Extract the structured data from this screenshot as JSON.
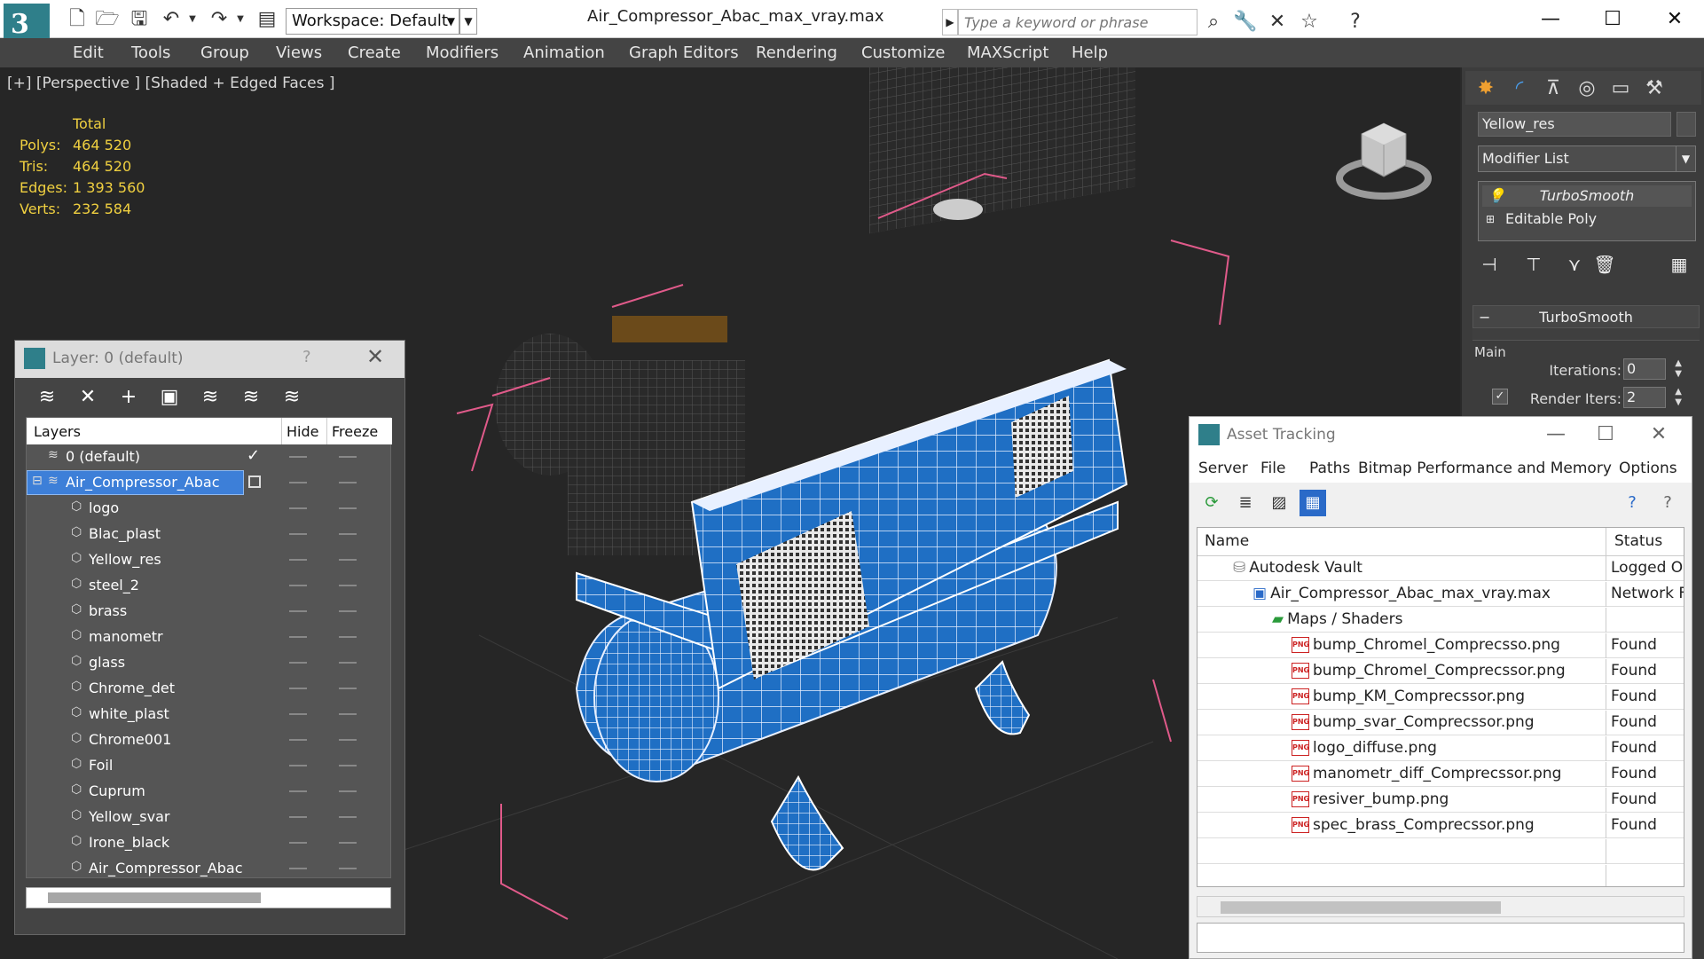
{
  "titlebar": {
    "workspace": "Workspace: Default",
    "document_title": "Air_Compressor_Abac_max_vray.max",
    "search_placeholder": "Type a keyword or phrase"
  },
  "menu": [
    "Edit",
    "Tools",
    "Group",
    "Views",
    "Create",
    "Modifiers",
    "Animation",
    "Graph Editors",
    "Rendering",
    "Customize",
    "MAXScript",
    "Help"
  ],
  "viewport": {
    "label": "[+] [Perspective ] [Shaded + Edged Faces ]",
    "stats": {
      "header": "Total",
      "rows": [
        {
          "label": "Polys:",
          "value": "464 520"
        },
        {
          "label": "Tris:",
          "value": "464 520"
        },
        {
          "label": "Edges:",
          "value": "1 393 560"
        },
        {
          "label": "Verts:",
          "value": "232 584"
        }
      ]
    }
  },
  "command_panel": {
    "object_name": "Yellow_res",
    "modifier_list": "Modifier List",
    "stack": [
      "TurboSmooth",
      "Editable Poly"
    ],
    "rollout_title": "TurboSmooth",
    "group_label": "Main",
    "iterations_label": "Iterations:",
    "iterations_value": "0",
    "render_iters_label": "Render Iters:",
    "render_iters_value": "2"
  },
  "layer_dialog": {
    "title": "Layer: 0 (default)",
    "help": "?",
    "columns": {
      "layers": "Layers",
      "hide": "Hide",
      "freeze": "Freeze"
    },
    "rows": [
      {
        "name": "0 (default)",
        "level": 0,
        "kind": "layer"
      },
      {
        "name": "Air_Compressor_Abac",
        "level": 0,
        "kind": "layer",
        "selected": true
      },
      {
        "name": "logo",
        "level": 1,
        "kind": "object"
      },
      {
        "name": "Blac_plast",
        "level": 1,
        "kind": "object"
      },
      {
        "name": "Yellow_res",
        "level": 1,
        "kind": "object"
      },
      {
        "name": "steel_2",
        "level": 1,
        "kind": "object"
      },
      {
        "name": "brass",
        "level": 1,
        "kind": "object"
      },
      {
        "name": "manometr",
        "level": 1,
        "kind": "object"
      },
      {
        "name": "glass",
        "level": 1,
        "kind": "object"
      },
      {
        "name": "Chrome_det",
        "level": 1,
        "kind": "object"
      },
      {
        "name": "white_plast",
        "level": 1,
        "kind": "object"
      },
      {
        "name": "Chrome001",
        "level": 1,
        "kind": "object"
      },
      {
        "name": "Foil",
        "level": 1,
        "kind": "object"
      },
      {
        "name": "Cuprum",
        "level": 1,
        "kind": "object"
      },
      {
        "name": "Yellow_svar",
        "level": 1,
        "kind": "object"
      },
      {
        "name": "Irone_black",
        "level": 1,
        "kind": "object"
      },
      {
        "name": "Air_Compressor_Abac",
        "level": 1,
        "kind": "object"
      }
    ]
  },
  "asset_dialog": {
    "title": "Asset Tracking",
    "menu": [
      "Server",
      "File",
      "Paths",
      "Bitmap Performance and Memory",
      "Options"
    ],
    "columns": {
      "name": "Name",
      "status": "Status"
    },
    "rows": [
      {
        "name": "Autodesk Vault",
        "status": "Logged O",
        "level": 0,
        "icon": "vault"
      },
      {
        "name": "Air_Compressor_Abac_max_vray.max",
        "status": "Network F",
        "level": 1,
        "icon": "max"
      },
      {
        "name": "Maps / Shaders",
        "status": "",
        "level": 2,
        "icon": "maps"
      },
      {
        "name": "bump_Chromel_Comprecsso.png",
        "status": "Found",
        "level": 3,
        "icon": "png"
      },
      {
        "name": "bump_Chromel_Comprecssor.png",
        "status": "Found",
        "level": 3,
        "icon": "png"
      },
      {
        "name": "bump_KM_Comprecssor.png",
        "status": "Found",
        "level": 3,
        "icon": "png"
      },
      {
        "name": "bump_svar_Comprecssor.png",
        "status": "Found",
        "level": 3,
        "icon": "png"
      },
      {
        "name": "logo_diffuse.png",
        "status": "Found",
        "level": 3,
        "icon": "png"
      },
      {
        "name": "manometr_diff_Comprecssor.png",
        "status": "Found",
        "level": 3,
        "icon": "png"
      },
      {
        "name": "resiver_bump.png",
        "status": "Found",
        "level": 3,
        "icon": "png"
      },
      {
        "name": "spec_brass_Comprecssor.png",
        "status": "Found",
        "level": 3,
        "icon": "png"
      }
    ]
  },
  "colors": {
    "stats_yellow": "#f0d040",
    "selection_blue": "#3d7fd8",
    "mesh_blue": "#1f6fc4",
    "bbox_pink": "#e05a8a"
  }
}
